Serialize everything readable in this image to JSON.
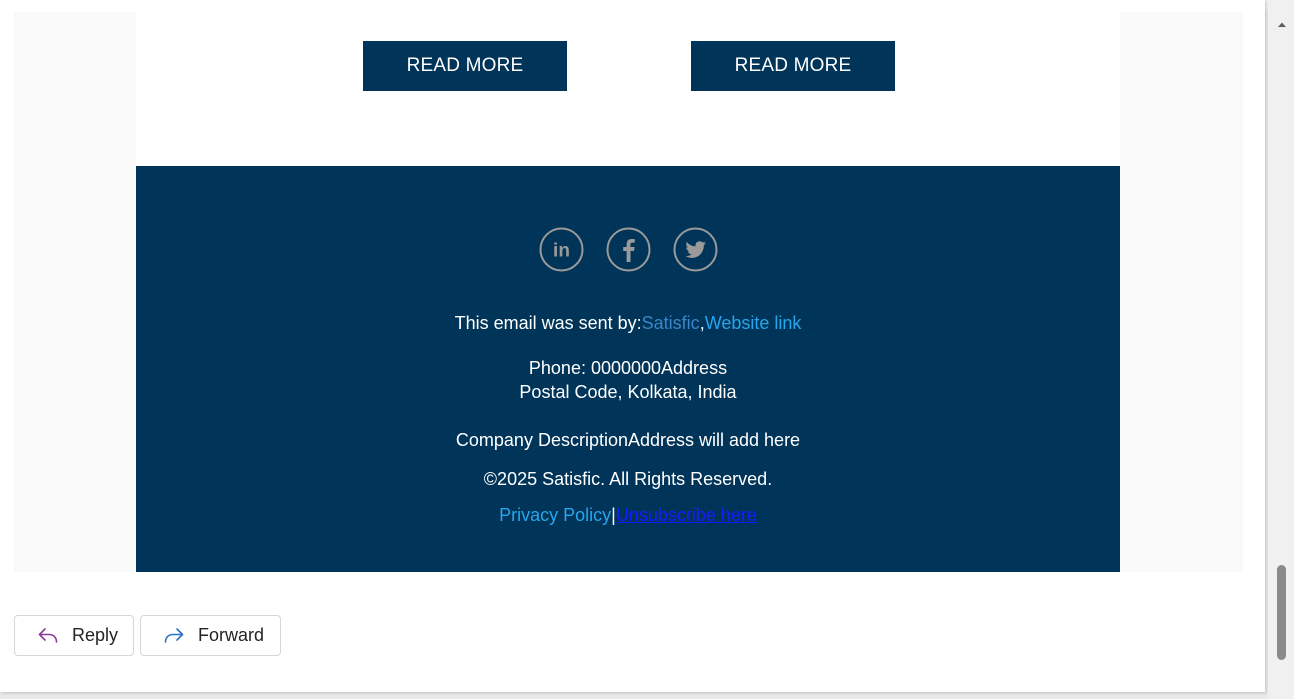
{
  "email": {
    "read_more_1": "READ MORE",
    "read_more_2": "READ MORE",
    "footer": {
      "social": [
        "linkedin-icon",
        "facebook-icon",
        "twitter-icon"
      ],
      "sent_by_prefix": "This email was sent by:",
      "sender_link": "Satisfic",
      "comma": ",",
      "website_link": "Website link",
      "phone_line": "Phone: 0000000Address",
      "postal_line": "Postal Code, Kolkata, India",
      "description_line": "Company DescriptionAddress will add here",
      "copyright_line": "©2025 Satisfic. All Rights Reserved.",
      "privacy_link": "Privacy Policy",
      "separator": "|",
      "unsubscribe_link": "Unsubscribe here"
    },
    "colors": {
      "brand_navy": "#003459",
      "link_blue": "#27a5ec",
      "unsubscribe_blue": "#1a1aff"
    }
  },
  "actions": {
    "reply_label": "Reply",
    "forward_label": "Forward",
    "reply_icon": "reply-arrow-icon",
    "forward_icon": "forward-arrow-icon"
  },
  "scrollbar": {
    "up_icon": "scroll-up-arrow-icon"
  }
}
